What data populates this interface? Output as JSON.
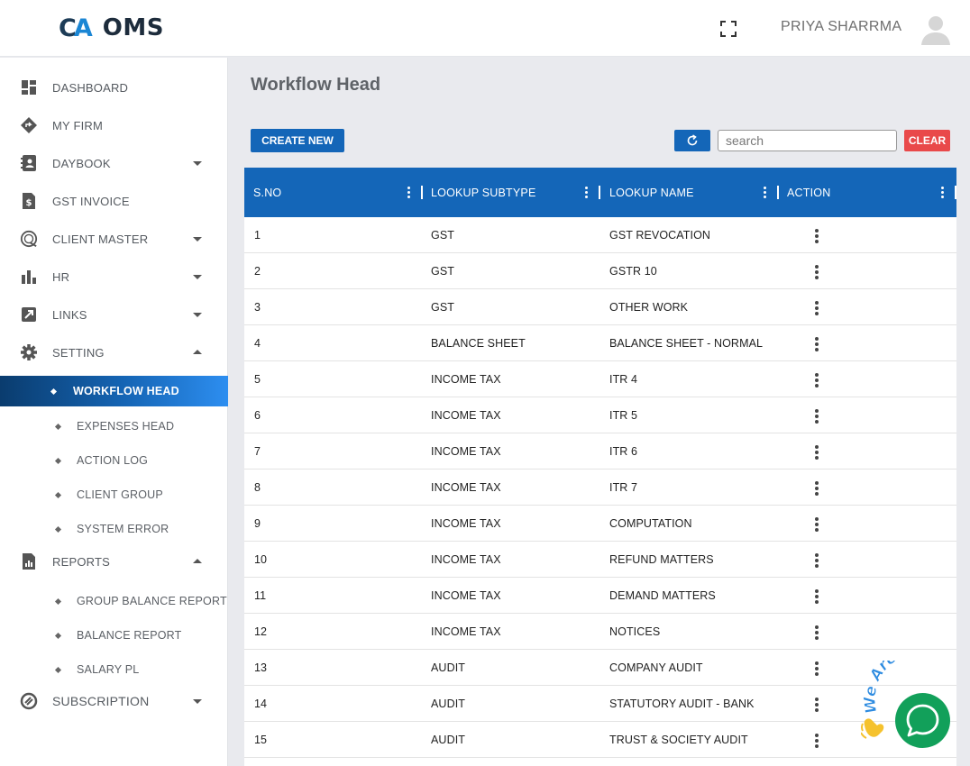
{
  "header": {
    "logo_mark_c": "C",
    "logo_mark_a": "A",
    "logo_text": "OMS",
    "user_name": "PRIYA SHARRMA",
    "icons": {
      "fullscreen": "fullscreen-icon",
      "avatar": "user-avatar-icon"
    }
  },
  "sidebar": {
    "items": [
      {
        "label": "DASHBOARD",
        "icon": "dashboard-icon",
        "caret": ""
      },
      {
        "label": "MY FIRM",
        "icon": "diamond-icon",
        "caret": ""
      },
      {
        "label": "DAYBOOK",
        "icon": "contact-book-icon",
        "caret": "down"
      },
      {
        "label": "GST INVOICE",
        "icon": "invoice-icon",
        "caret": ""
      },
      {
        "label": "CLIENT MASTER",
        "icon": "client-icon",
        "caret": "down"
      },
      {
        "label": "HR",
        "icon": "bar-chart-icon",
        "caret": "down"
      },
      {
        "label": "LINKS",
        "icon": "external-link-icon",
        "caret": "down"
      },
      {
        "label": "SETTING",
        "icon": "gear-icon",
        "caret": "up"
      }
    ],
    "setting_sub": [
      {
        "label": "WORKFLOW HEAD",
        "active": true
      },
      {
        "label": "EXPENSES HEAD"
      },
      {
        "label": "ACTION LOG"
      },
      {
        "label": "CLIENT GROUP"
      },
      {
        "label": "SYSTEM ERROR"
      }
    ],
    "reports": {
      "label": "REPORTS",
      "icon": "report-icon",
      "caret": "up"
    },
    "reports_sub": [
      {
        "label": "GROUP BALANCE REPORT"
      },
      {
        "label": "BALANCE REPORT"
      },
      {
        "label": "SALARY PL"
      }
    ],
    "subscription": {
      "label": "SUBSCRIPTION",
      "icon": "subscription-icon",
      "caret": "down"
    }
  },
  "main": {
    "title": "Workflow Head",
    "create_label": "CREATE NEW",
    "search_placeholder": "search",
    "clear_label": "CLEAR",
    "refresh_icon": "refresh-icon"
  },
  "table": {
    "columns": [
      "S.NO",
      "LOOKUP SUBTYPE",
      "LOOKUP NAME",
      "ACTION"
    ],
    "rows": [
      [
        "1",
        "GST",
        "GST REVOCATION"
      ],
      [
        "2",
        "GST",
        "GSTR 10"
      ],
      [
        "3",
        "GST",
        "OTHER WORK"
      ],
      [
        "4",
        "BALANCE SHEET",
        "BALANCE SHEET - NORMAL"
      ],
      [
        "5",
        "INCOME TAX",
        "ITR 4"
      ],
      [
        "6",
        "INCOME TAX",
        "ITR 5"
      ],
      [
        "7",
        "INCOME TAX",
        "ITR 6"
      ],
      [
        "8",
        "INCOME TAX",
        "ITR 7"
      ],
      [
        "9",
        "INCOME TAX",
        "COMPUTATION"
      ],
      [
        "10",
        "INCOME TAX",
        "REFUND MATTERS"
      ],
      [
        "11",
        "INCOME TAX",
        "DEMAND MATTERS"
      ],
      [
        "12",
        "INCOME TAX",
        "NOTICES"
      ],
      [
        "13",
        "AUDIT",
        "COMPANY AUDIT"
      ],
      [
        "14",
        "AUDIT",
        "STATUTORY AUDIT - BANK"
      ],
      [
        "15",
        "AUDIT",
        "TRUST & SOCIETY AUDIT"
      ]
    ]
  },
  "chat": {
    "tagline": "We Are Here!",
    "icon": "chat-bubble-icon",
    "wave_icon": "waving-hand-icon"
  },
  "colors": {
    "primary": "#1466b8",
    "danger": "#e9494a",
    "chat": "#12a05a"
  }
}
